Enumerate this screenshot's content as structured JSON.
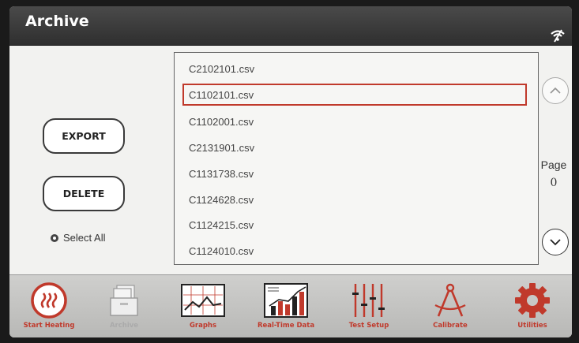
{
  "header": {
    "title": "Archive"
  },
  "actions": {
    "export_label": "EXPORT",
    "delete_label": "DELETE",
    "select_all_label": "Select All"
  },
  "files": [
    {
      "name": "C2102101.csv",
      "selected": false
    },
    {
      "name": "C1102101.csv",
      "selected": true
    },
    {
      "name": "C1102001.csv",
      "selected": false
    },
    {
      "name": "C2131901.csv",
      "selected": false
    },
    {
      "name": "C1131738.csv",
      "selected": false
    },
    {
      "name": "C1124628.csv",
      "selected": false
    },
    {
      "name": "C1124215.csv",
      "selected": false
    },
    {
      "name": "C1124010.csv",
      "selected": false
    }
  ],
  "pager": {
    "label": "Page",
    "number": "0"
  },
  "toolbar": {
    "items": [
      {
        "label": "Start Heating",
        "icon": "heating-icon"
      },
      {
        "label": "Archive",
        "icon": "archive-icon"
      },
      {
        "label": "Graphs",
        "icon": "graph-icon"
      },
      {
        "label": "Real-Time Data",
        "icon": "realtime-chart-icon"
      },
      {
        "label": "Test Setup",
        "icon": "sliders-icon"
      },
      {
        "label": "Calibrate",
        "icon": "compass-icon"
      },
      {
        "label": "Utilities",
        "icon": "gear-icon"
      }
    ]
  },
  "colors": {
    "accent": "#c0392b",
    "selection_border": "#c0392b",
    "titlebar": "#3a3a3a"
  }
}
